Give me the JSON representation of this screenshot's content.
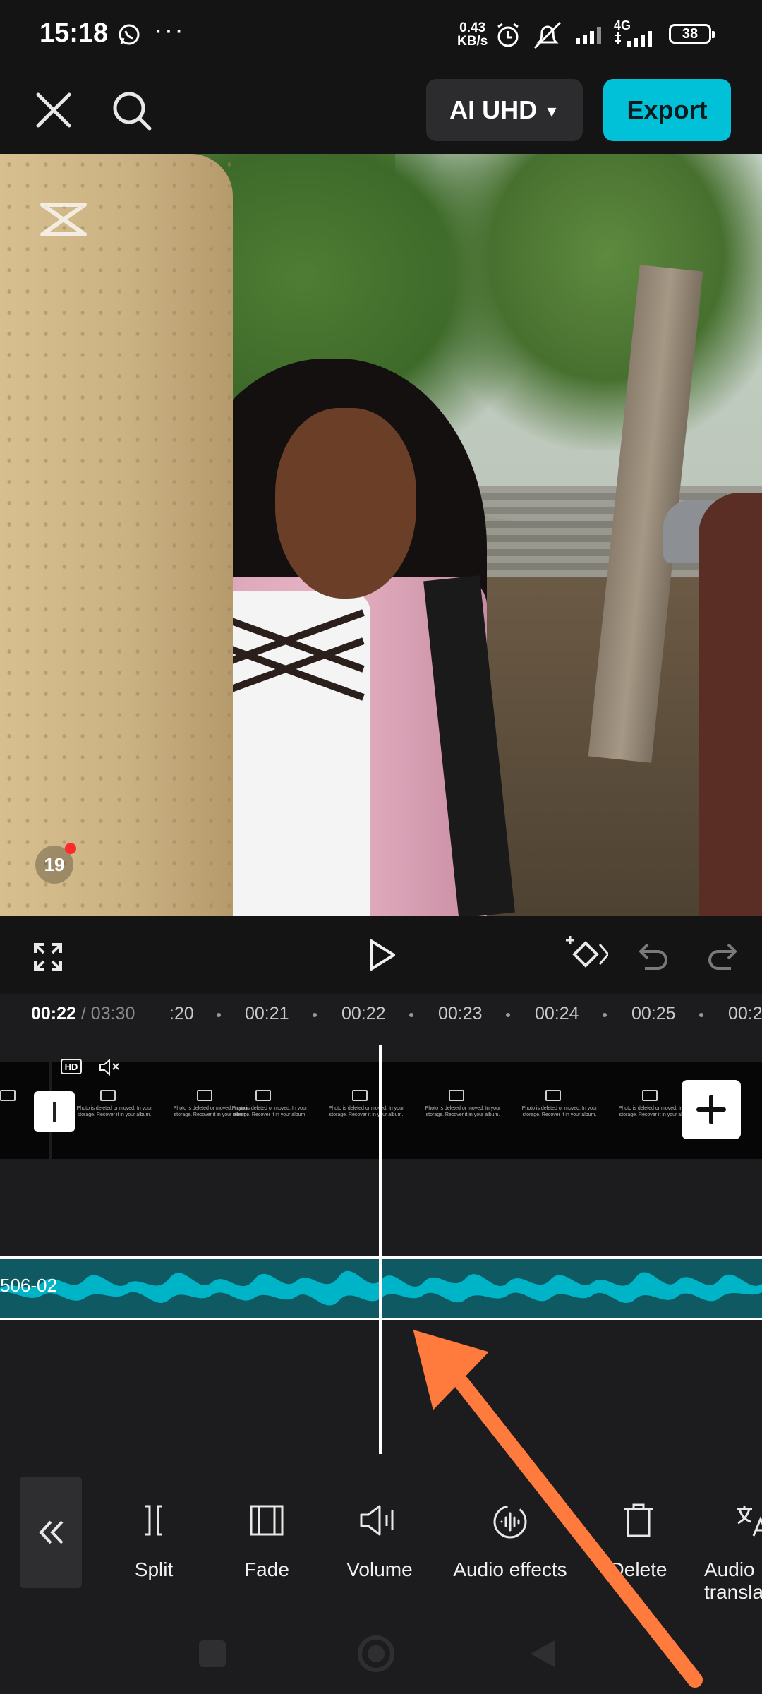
{
  "status_bar": {
    "time": "15:18",
    "more": "···",
    "net_speed_value": "0.43",
    "net_speed_unit": "KB/s",
    "network_type": "4G",
    "battery": "38"
  },
  "toolbar": {
    "resolution_label": "AI UHD",
    "export_label": "Export"
  },
  "preview": {
    "notification_count": "19"
  },
  "timeline": {
    "current_time": "00:22",
    "total_time": "/ 03:30",
    "ruler_ticks": [
      ":20",
      "00:21",
      "00:22",
      "00:23",
      "00:24",
      "00:25",
      "00:2"
    ],
    "hd_badge": "HD",
    "frame_caption": "Photo is deleted or moved. In your storage. Recover it in your album.",
    "audio_clip_label": "506-02"
  },
  "tools": [
    {
      "label": "Split",
      "icon": "split-icon"
    },
    {
      "label": "Fade",
      "icon": "fade-icon"
    },
    {
      "label": "Volume",
      "icon": "volume-icon"
    },
    {
      "label": "Audio effects",
      "icon": "audio-effects-icon"
    },
    {
      "label": "Delete",
      "icon": "delete-icon"
    },
    {
      "label": "Audio translate",
      "icon": "audio-translate-icon"
    }
  ],
  "colors": {
    "accent": "#00c1d8",
    "waveform": "#00b4c8",
    "annotation_arrow": "#ff7a3d"
  }
}
